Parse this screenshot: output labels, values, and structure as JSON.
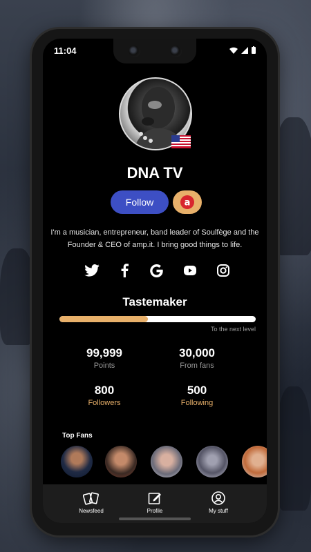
{
  "status_bar": {
    "time": "11:04"
  },
  "profile": {
    "name": "DNA TV",
    "follow_label": "Follow",
    "bio": "I'm a musician, entrepreneur, band leader of Soulfège and the Founder & CEO of amp.it. I bring good things to life.",
    "country_flag": "us-flag-icon"
  },
  "socials": [
    "twitter-icon",
    "facebook-icon",
    "google-icon",
    "youtube-icon",
    "instagram-icon"
  ],
  "level": {
    "title": "Tastemaker",
    "progress_fraction": 0.45,
    "next_level_text": "To the next level"
  },
  "stats": {
    "points": {
      "value": "99,999",
      "label": "Points"
    },
    "from_fans": {
      "value": "30,000",
      "label": "From fans"
    },
    "followers": {
      "value": "800",
      "label": "Followers"
    },
    "following": {
      "value": "500",
      "label": "Following"
    }
  },
  "top_fans": {
    "title": "Top Fans"
  },
  "nav": {
    "newsfeed": "Newsfeed",
    "profile": "Profile",
    "my_stuff": "My stuff"
  },
  "colors": {
    "accent_gold": "#e8b06a",
    "follow_blue": "#3d4fc4"
  }
}
